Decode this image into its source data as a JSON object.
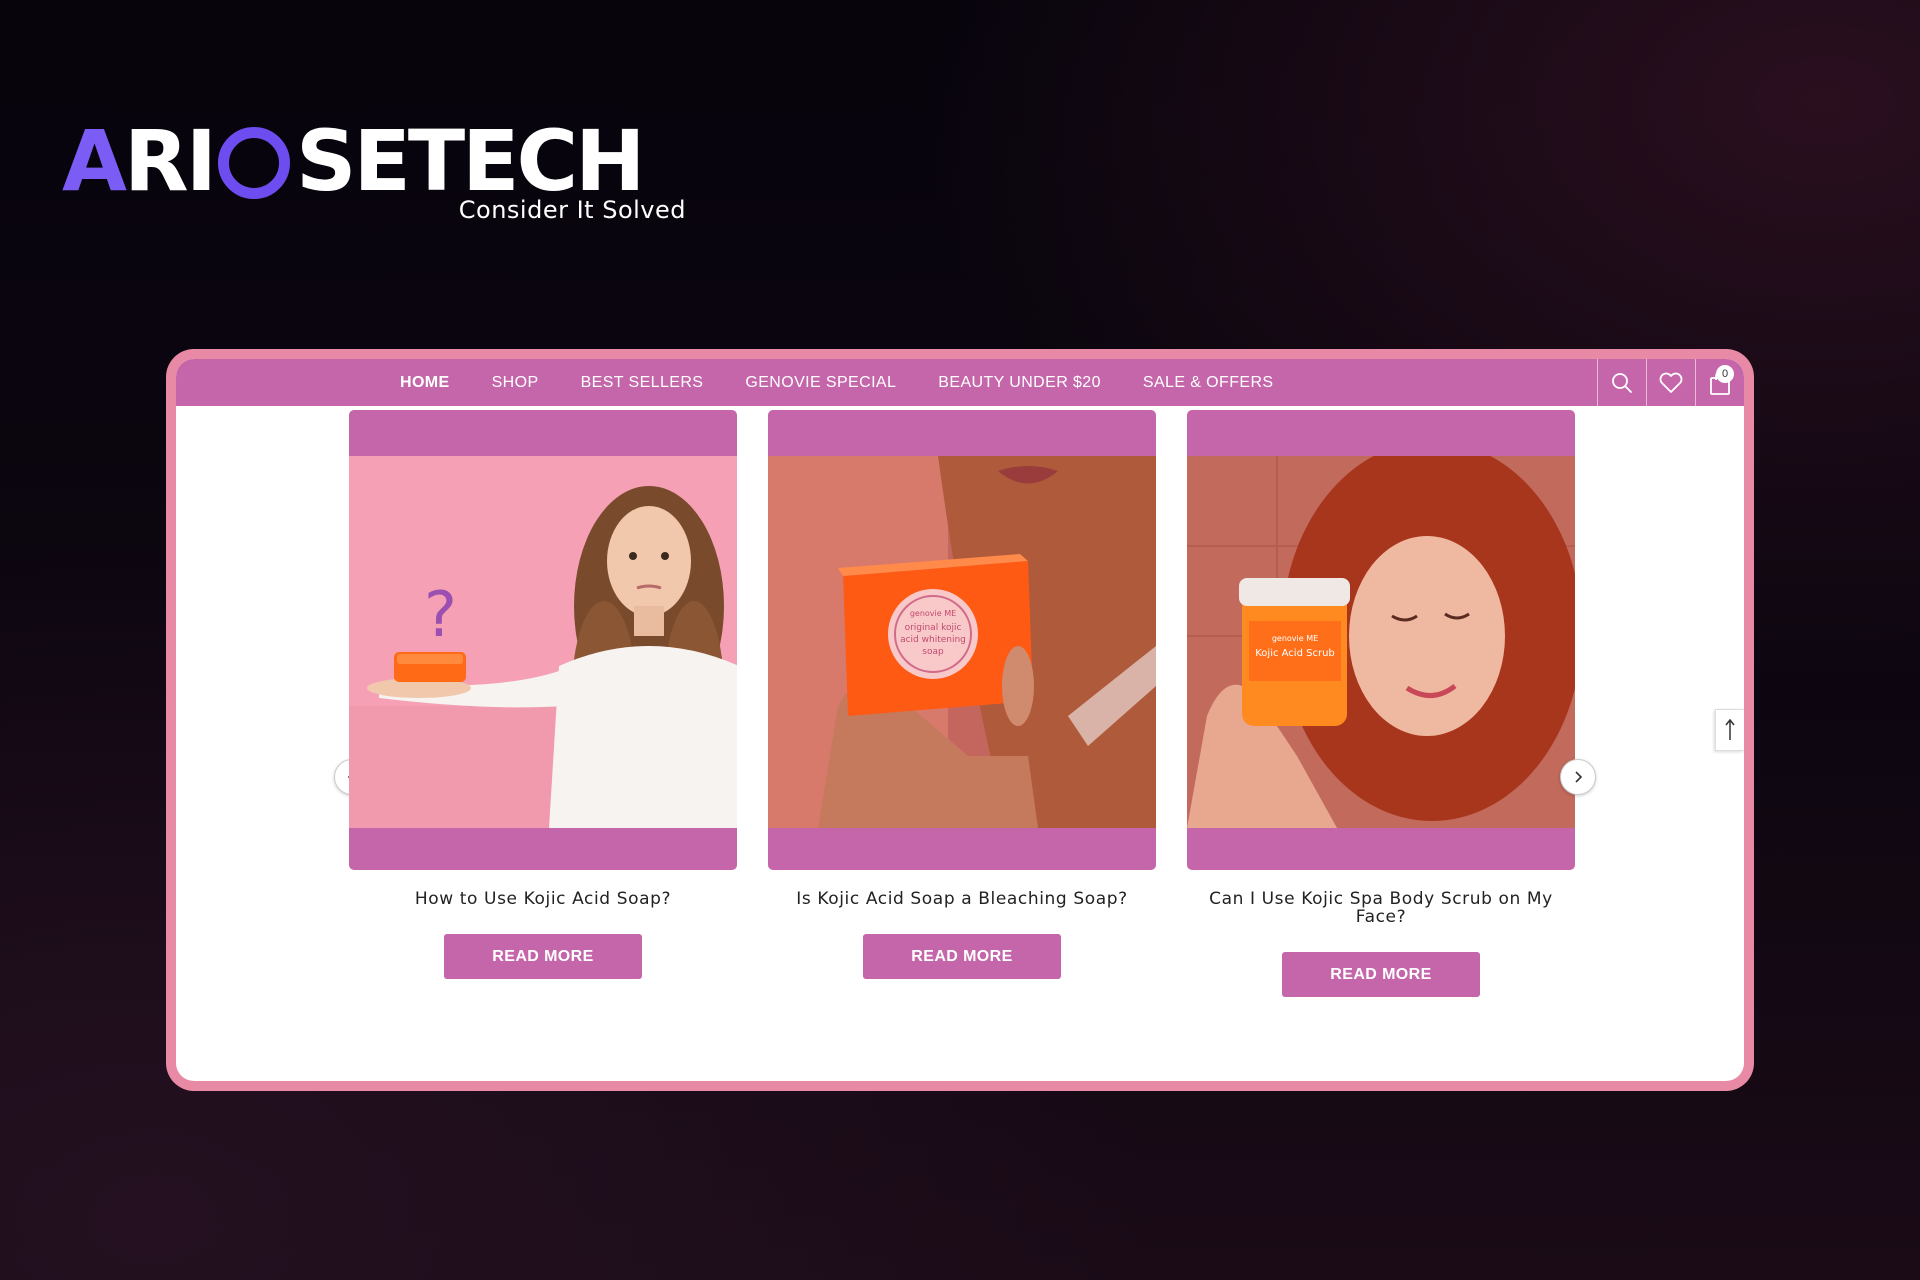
{
  "brand": {
    "logo_parts": [
      "A",
      "RI",
      "SETECH"
    ],
    "tagline": "Consider It Solved"
  },
  "colors": {
    "accent": "#c566ab",
    "frame": "#e88aa5",
    "logo_purple": "#6e4df0"
  },
  "nav": {
    "items": [
      {
        "label": "HOME",
        "active": true
      },
      {
        "label": "SHOP"
      },
      {
        "label": "BEST SELLERS"
      },
      {
        "label": "GENOVIE SPECIAL"
      },
      {
        "label": "BEAUTY UNDER $20"
      },
      {
        "label": "SALE & OFFERS"
      }
    ],
    "icons": [
      "search-icon",
      "heart-icon",
      "shopping-bag-icon"
    ],
    "cart_count": "0"
  },
  "posts": [
    {
      "title": "How to Use Kojic Acid Soap?",
      "button": "READ MORE"
    },
    {
      "title": "Is Kojic Acid Soap a Bleaching Soap?",
      "button": "READ MORE"
    },
    {
      "title": "Can I Use Kojic Spa Body Scrub on My Face?",
      "button": "READ MORE"
    }
  ],
  "product_labels": {
    "soap_1": "genovie ME",
    "soap_2": "original kojic",
    "soap_3": "acid whitening",
    "soap_4": "soap",
    "scrub_1": "genovie ME",
    "scrub_2": "Kojic Acid Scrub"
  }
}
